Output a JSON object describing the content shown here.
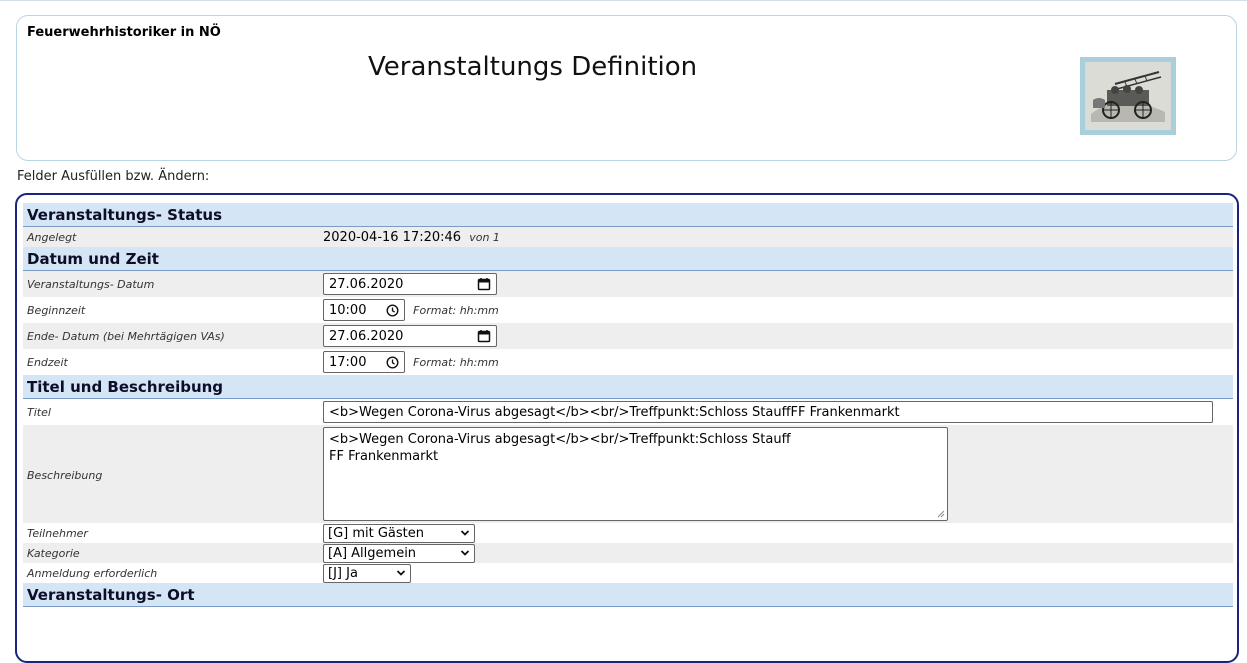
{
  "header": {
    "site_name": "Feuerwehrhistoriker in NÖ",
    "page_title": "Veranstaltungs Definition",
    "logo_icon": "fire-engine-logo"
  },
  "instructions": "Felder Ausfüllen bzw. Ändern:",
  "sections": {
    "status": {
      "title": "Veranstaltungs- Status",
      "created_label": "Angelegt",
      "created_value": "2020-04-16 17:20:46",
      "created_by": "von 1"
    },
    "datetime": {
      "title": "Datum und Zeit",
      "event_date_label": "Veranstaltungs- Datum",
      "event_date_value": "27.06.2020",
      "start_time_label": "Beginnzeit",
      "start_time_value": "10:00",
      "format_hint": "Format: hh:mm",
      "end_date_label": "Ende- Datum (bei Mehrtägigen VAs)",
      "end_date_value": "27.06.2020",
      "end_time_label": "Endzeit",
      "end_time_value": "17:00"
    },
    "title_desc": {
      "title": "Titel und Beschreibung",
      "title_label": "Titel",
      "title_value": "<b>Wegen Corona-Virus abgesagt</b><br/>Treffpunkt:Schloss StauffFF Frankenmarkt",
      "desc_label": "Beschreibung",
      "desc_line1": "<b>Wegen Corona-Virus abgesagt</b><br/>Treffpunkt:Schloss Stauff",
      "desc_line2": "FF Frankenmarkt",
      "participants_label": "Teilnehmer",
      "participants_value": "[G] mit Gästen",
      "category_label": "Kategorie",
      "category_value": "[A] Allgemein",
      "registration_label": "Anmeldung erforderlich",
      "registration_value": "[J] Ja"
    },
    "location": {
      "title": "Veranstaltungs- Ort"
    }
  },
  "icons": {
    "calendar": "calendar-icon",
    "clock": "clock-icon",
    "chevron": "chevron-down-icon"
  },
  "colors": {
    "section_bg": "#d4e6f5",
    "form_border": "#1a237e",
    "header_border": "#b9d5e2",
    "shade_row": "#eeeeee"
  }
}
